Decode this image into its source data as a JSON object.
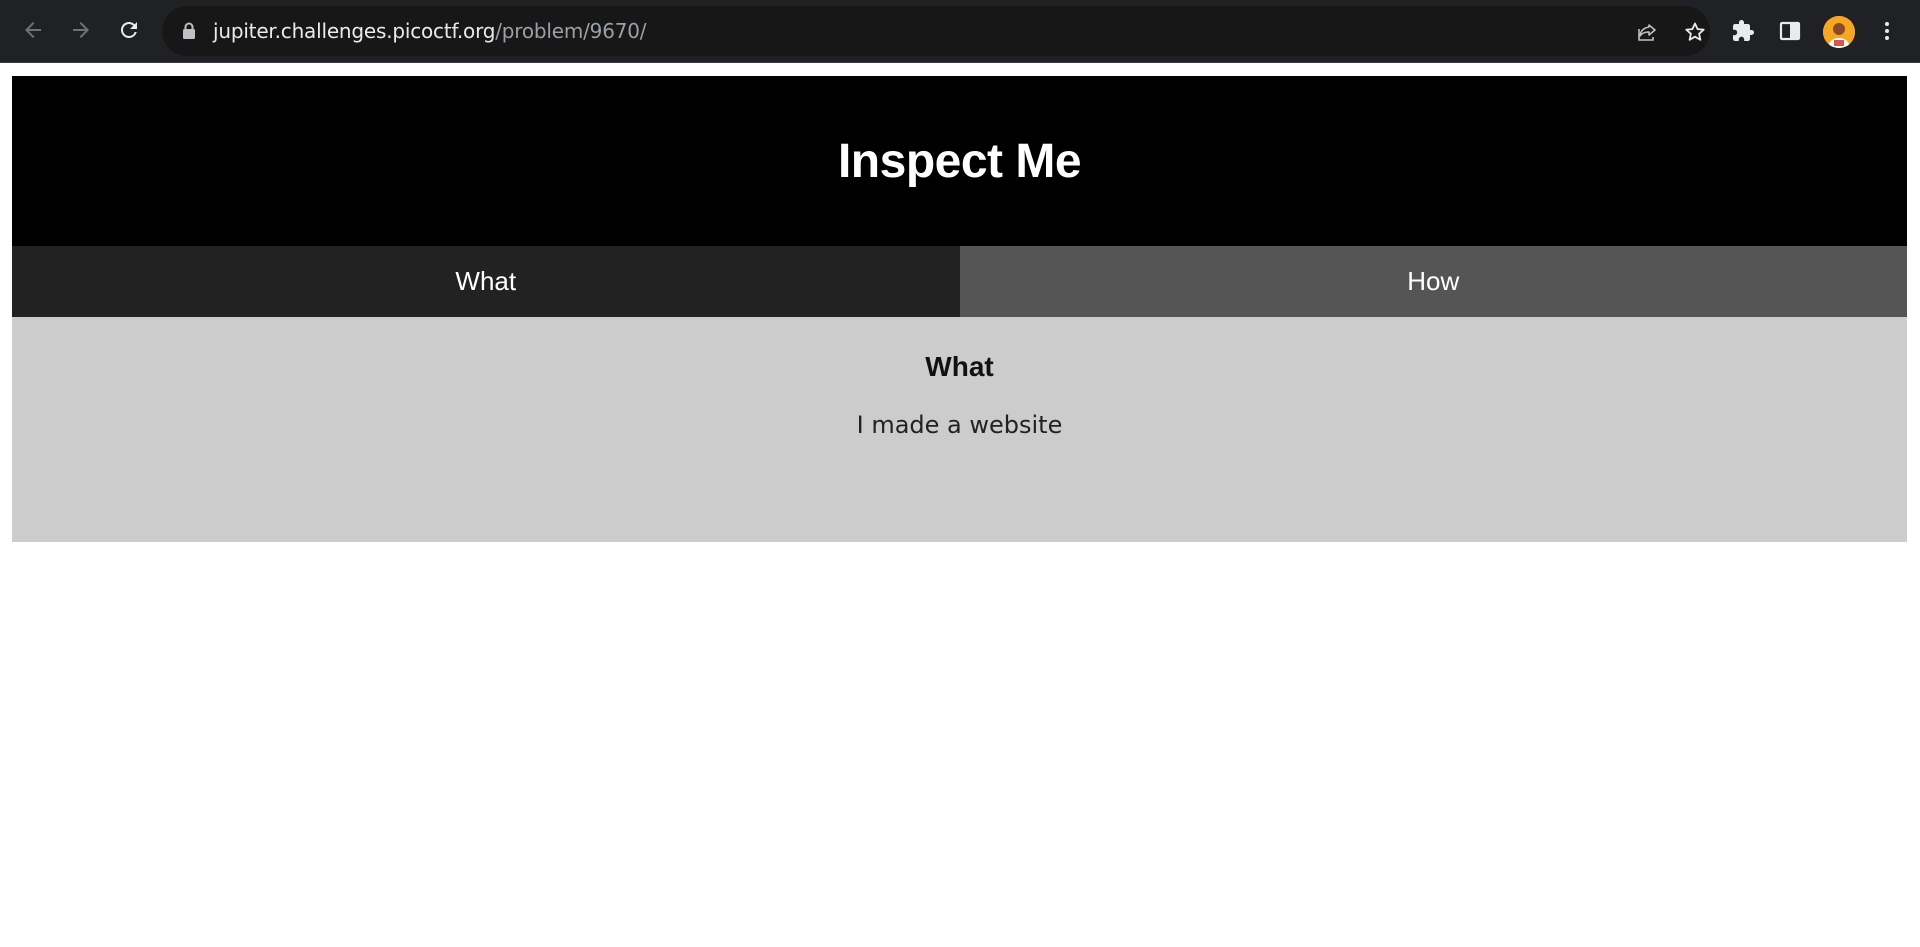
{
  "browser": {
    "url_host": "jupiter.challenges.picoctf.org",
    "url_path": "/problem/9670/",
    "icons": {
      "back": "back-arrow-icon",
      "forward": "forward-arrow-icon",
      "reload": "reload-icon",
      "lock": "lock-icon",
      "share": "share-icon",
      "bookmark": "star-icon",
      "extensions": "puzzle-icon",
      "side_panel": "side-panel-icon",
      "profile": "avatar",
      "menu": "kebab-menu-icon"
    }
  },
  "page": {
    "title": "Inspect Me",
    "tabs": [
      {
        "label": "What",
        "active": true
      },
      {
        "label": "How",
        "active": false
      }
    ],
    "content": {
      "heading": "What",
      "text": "I made a website"
    }
  },
  "colors": {
    "header_bg": "#000000",
    "tab_what_bg": "#222222",
    "tab_how_bg": "#555555",
    "content_bg": "#cccccc",
    "chrome_bg": "#202124"
  }
}
